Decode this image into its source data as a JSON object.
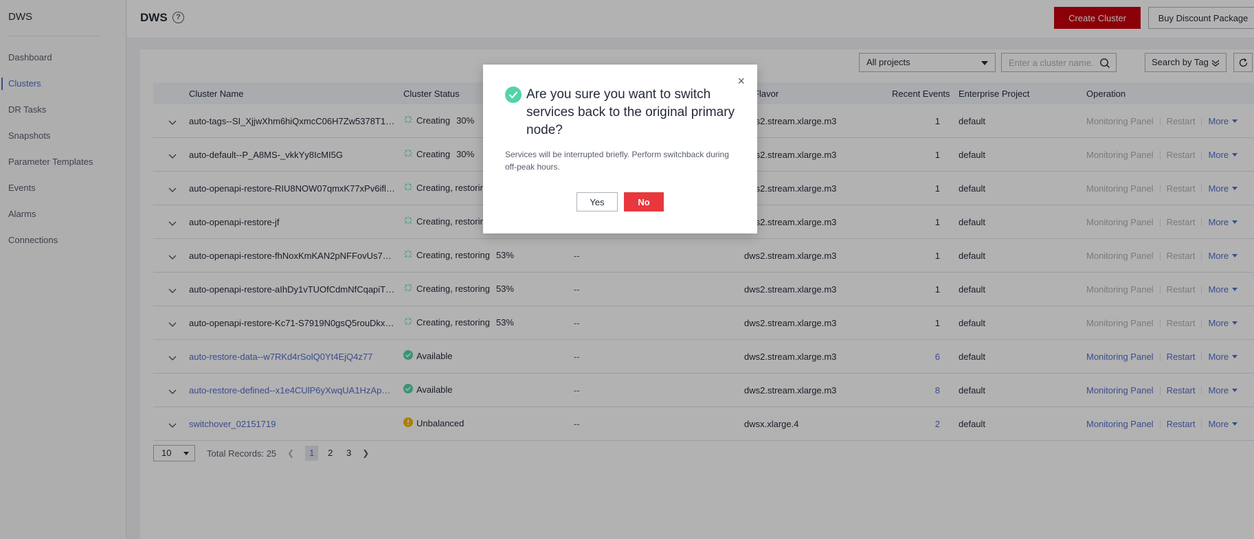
{
  "sidebar": {
    "brand": "DWS",
    "items": [
      {
        "label": "Dashboard"
      },
      {
        "label": "Clusters"
      },
      {
        "label": "DR Tasks"
      },
      {
        "label": "Snapshots"
      },
      {
        "label": "Parameter Templates"
      },
      {
        "label": "Events"
      },
      {
        "label": "Alarms"
      },
      {
        "label": "Connections"
      }
    ]
  },
  "header": {
    "title": "DWS",
    "help_glyph": "?",
    "create_label": "Create Cluster",
    "discount_label": "Buy Discount Package"
  },
  "filters": {
    "project_value": "All projects",
    "search_placeholder": "Enter a cluster name.",
    "tag_search_label": "Search by Tag"
  },
  "table": {
    "columns": {
      "name": "Cluster Name",
      "status": "Cluster Status",
      "flavor": "de Flavor",
      "events": "Recent Events",
      "project": "Enterprise Project",
      "operation": "Operation"
    },
    "ops": {
      "monitor": "Monitoring Panel",
      "restart": "Restart",
      "more": "More"
    },
    "rows": [
      {
        "name": "auto-tags--SI_XjjwXhm6hiQxmcC06H7Zw5378T1wz...",
        "status": "Creating",
        "progress": "30%",
        "addr": "",
        "flavor": "dws2.stream.xlarge.m3",
        "events": "1",
        "project": "default"
      },
      {
        "name": "auto-default--P_A8MS-_vkkYy8IcMI5G",
        "status": "Creating",
        "progress": "30%",
        "addr": "",
        "flavor": "dws2.stream.xlarge.m3",
        "events": "1",
        "project": "default"
      },
      {
        "name": "auto-openapi-restore-RIU8NOW07qmxK77xPv6ifllD...",
        "status": "Creating, restoring",
        "progress": "",
        "addr": "",
        "flavor": "dws2.stream.xlarge.m3",
        "events": "1",
        "project": "default"
      },
      {
        "name": "auto-openapi-restore-jf",
        "status": "Creating, restoring",
        "progress": "",
        "addr": "",
        "flavor": "dws2.stream.xlarge.m3",
        "events": "1",
        "project": "default"
      },
      {
        "name": "auto-openapi-restore-fhNoxKmKAN2pNFFovUs70bf...",
        "status": "Creating, restoring",
        "progress": "53%",
        "addr": "--",
        "flavor": "dws2.stream.xlarge.m3",
        "events": "1",
        "project": "default"
      },
      {
        "name": "auto-openapi-restore-aIhDy1vTUOfCdmNfCqapiTx_...",
        "status": "Creating, restoring",
        "progress": "53%",
        "addr": "--",
        "flavor": "dws2.stream.xlarge.m3",
        "events": "1",
        "project": "default"
      },
      {
        "name": "auto-openapi-restore-Kc71-S7919N0gsQ5rouDkxK...",
        "status": "Creating, restoring",
        "progress": "53%",
        "addr": "--",
        "flavor": "dws2.stream.xlarge.m3",
        "events": "1",
        "project": "default"
      },
      {
        "name": "auto-restore-data--w7RKd4rSolQ0Yt4EjQ4z77",
        "status": "Available",
        "progress": "",
        "addr": "--",
        "flavor": "dws2.stream.xlarge.m3",
        "events": "6",
        "project": "default"
      },
      {
        "name": "auto-restore-defined--x1e4CUlP6yXwqUA1HzApVW...",
        "status": "Available",
        "progress": "",
        "addr": "--",
        "flavor": "dws2.stream.xlarge.m3",
        "events": "8",
        "project": "default"
      },
      {
        "name": "switchover_02151719",
        "status": "Unbalanced",
        "progress": "",
        "addr": "--",
        "flavor": "dwsx.xlarge.4",
        "events": "2",
        "project": "default"
      }
    ]
  },
  "pager": {
    "page_size": "10",
    "total": "Total Records: 25",
    "pages": [
      "1",
      "2",
      "3"
    ]
  },
  "dialog": {
    "title": "Are you sure you want to switch services back to the original primary node?",
    "body": "Services will be interrupted briefly. Perform switchback during off-peak hours.",
    "yes_label": "Yes",
    "no_label": "No",
    "close_glyph": "×"
  },
  "colors": {
    "accent": "#526ecc",
    "brand_red": "#c7000b",
    "danger": "#e8383d",
    "success": "#50d4ab",
    "warning": "#f5b800"
  }
}
